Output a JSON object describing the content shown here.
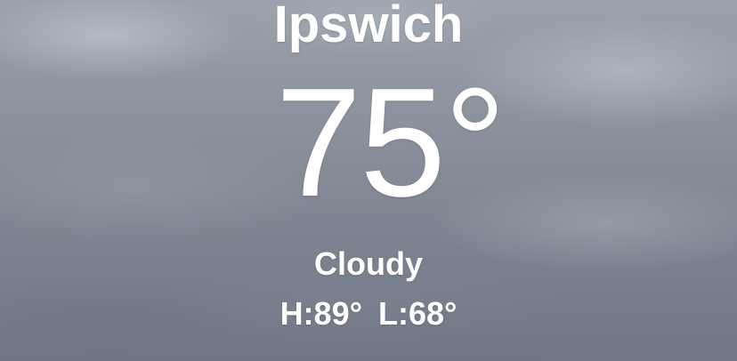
{
  "weather": {
    "city": "Ipswich",
    "temperature": "75°",
    "condition": "Cloudy",
    "high": "H:89°",
    "low": "L:68°"
  },
  "background": {
    "theme": "overcast-clouds",
    "colors": [
      "#9aa1ab",
      "#7f8693",
      "#6f7684"
    ]
  }
}
